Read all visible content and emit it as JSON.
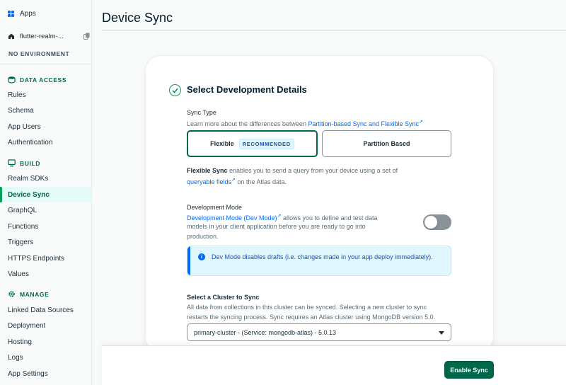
{
  "sidebar": {
    "apps_label": "Apps",
    "app_name": "flutter-realm-...",
    "environment": "NO ENVIRONMENT",
    "sections": [
      {
        "title": "DATA ACCESS",
        "items": [
          "Rules",
          "Schema",
          "App Users",
          "Authentication"
        ]
      },
      {
        "title": "BUILD",
        "items": [
          "Realm SDKs",
          "Device Sync",
          "GraphQL",
          "Functions",
          "Triggers",
          "HTTPS Endpoints",
          "Values"
        ]
      },
      {
        "title": "MANAGE",
        "items": [
          "Linked Data Sources",
          "Deployment",
          "Hosting",
          "Logs",
          "App Settings"
        ]
      }
    ],
    "active_item": "Device Sync"
  },
  "page": {
    "title": "Device Sync"
  },
  "card": {
    "title": "Select Development Details",
    "sync_type": {
      "label": "Sync Type",
      "help_prefix": "Learn more about the differences between ",
      "help_link": "Partition-based Sync and Flexible Sync",
      "options": [
        {
          "label": "Flexible",
          "badge": "RECOMMENDED",
          "selected": true
        },
        {
          "label": "Partition Based",
          "selected": false
        }
      ],
      "desc_bold": "Flexible Sync",
      "desc_mid": " enables you to send a query from your device using a set of",
      "desc_link": "queryable fields",
      "desc_end": " on the Atlas data."
    },
    "dev_mode": {
      "label": "Development Mode",
      "link": "Development Mode (Dev Mode)",
      "desc_line1": " allows you to define and test data",
      "desc_line2": "models in your client application before you are ready to go into",
      "desc_line3": "production.",
      "enabled": false,
      "callout": "Dev Mode disables drafts (i.e. changes made in your app deploy immediately)."
    },
    "cluster": {
      "label": "Select a Cluster to Sync",
      "desc_line1": "All data from collections in this cluster can be synced. Selecting a new cluster to sync",
      "desc_line2": "restarts the syncing process. Sync requires an Atlas cluster using MongoDB version 5.0.",
      "selected": "primary-cluster - (Service: mongodb-atlas) - 5.0.13"
    }
  },
  "footer": {
    "primary_button": "Enable Sync"
  },
  "colors": {
    "brand_green": "#00684a",
    "link_blue": "#016bf8",
    "callout_bg": "#e1f7ff"
  }
}
